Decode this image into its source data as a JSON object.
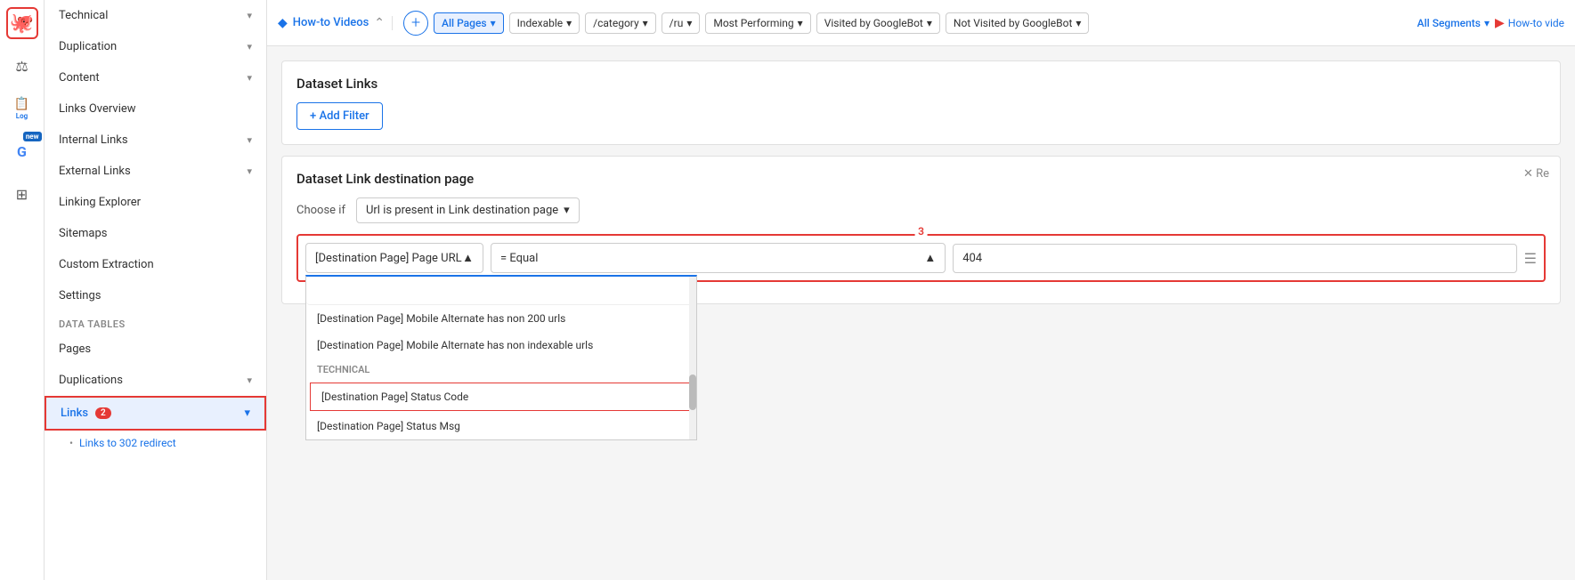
{
  "iconBar": {
    "items": [
      {
        "name": "octopus-logo",
        "symbol": "🐙",
        "active": true
      },
      {
        "name": "balance-icon",
        "symbol": "⚖",
        "active": false
      },
      {
        "name": "log-icon",
        "symbol": "📄",
        "active": false,
        "label": "Log"
      },
      {
        "name": "google-icon",
        "symbol": "G",
        "active": false,
        "isNew": true
      },
      {
        "name": "grid-icon",
        "symbol": "⊞",
        "active": false
      }
    ]
  },
  "sidebar": {
    "topItems": [
      {
        "id": "technical",
        "label": "Technical",
        "hasChevron": true
      },
      {
        "id": "duplication",
        "label": "Duplication",
        "hasChevron": true
      },
      {
        "id": "content",
        "label": "Content",
        "hasChevron": true
      },
      {
        "id": "links-overview",
        "label": "Links Overview",
        "hasChevron": false
      },
      {
        "id": "internal-links",
        "label": "Internal Links",
        "hasChevron": true
      },
      {
        "id": "external-links",
        "label": "External Links",
        "hasChevron": true
      },
      {
        "id": "linking-explorer",
        "label": "Linking Explorer",
        "hasChevron": false
      },
      {
        "id": "sitemaps",
        "label": "Sitemaps",
        "hasChevron": false
      },
      {
        "id": "custom-extraction",
        "label": "Custom Extraction",
        "hasChevron": false
      },
      {
        "id": "settings",
        "label": "Settings",
        "hasChevron": false
      }
    ],
    "dataTables": {
      "label": "Data Tables",
      "items": [
        {
          "id": "pages",
          "label": "Pages",
          "hasChevron": false
        },
        {
          "id": "duplications",
          "label": "Duplications",
          "hasChevron": true
        },
        {
          "id": "links",
          "label": "Links",
          "badge": "2",
          "hasChevron": true,
          "active": true
        }
      ]
    },
    "subItems": [
      {
        "id": "links-to-302",
        "label": "Links to 302 redirect"
      }
    ]
  },
  "topBar": {
    "title": "How-to Videos",
    "collapseSymbol": "⌃",
    "filters": [
      {
        "id": "all-pages",
        "label": "All Pages",
        "active": true,
        "hasDropdown": true
      },
      {
        "id": "indexable",
        "label": "Indexable",
        "active": false,
        "hasDropdown": true
      },
      {
        "id": "category",
        "label": "/category",
        "active": false,
        "hasDropdown": true
      },
      {
        "id": "ru",
        "label": "/ru",
        "active": false,
        "hasDropdown": true
      },
      {
        "id": "most-performing",
        "label": "Most Performing",
        "active": false,
        "hasDropdown": true
      },
      {
        "id": "visited-by-googlebot",
        "label": "Visited by GoogleBot",
        "active": false,
        "hasDropdown": true
      },
      {
        "id": "not-visited-by-googlebot",
        "label": "Not Visited by GoogleBot",
        "active": false,
        "hasDropdown": true
      }
    ],
    "segments": "All Segments",
    "segmentsDropdown": true,
    "howToVideos": "How-to vide"
  },
  "datasetLinks": {
    "title": "Dataset Links",
    "addFilterLabel": "+ Add Filter"
  },
  "datasetDestination": {
    "title": "Dataset Link destination page",
    "closeLabel": "✕ Re",
    "chooseIfLabel": "Choose if",
    "urlDropdownLabel": "Url is present in Link destination page",
    "filterNumber": "3",
    "filterSelect": "[Destination Page] Page URL",
    "filterEqual": "= Equal",
    "filterValue": "404",
    "dropdownInput": "",
    "dropdownItems": [
      {
        "id": "mobile-alt-200",
        "label": "[Destination Page] Mobile Alternate has non 200 urls"
      },
      {
        "id": "mobile-alt-indexable",
        "label": "[Destination Page] Mobile Alternate has non indexable urls"
      }
    ],
    "technicalSection": "Technical",
    "technicalItems": [
      {
        "id": "status-code",
        "label": "[Destination Page] Status Code",
        "selected": true
      },
      {
        "id": "status-msg",
        "label": "[Destination Page] Status Msg"
      }
    ]
  }
}
